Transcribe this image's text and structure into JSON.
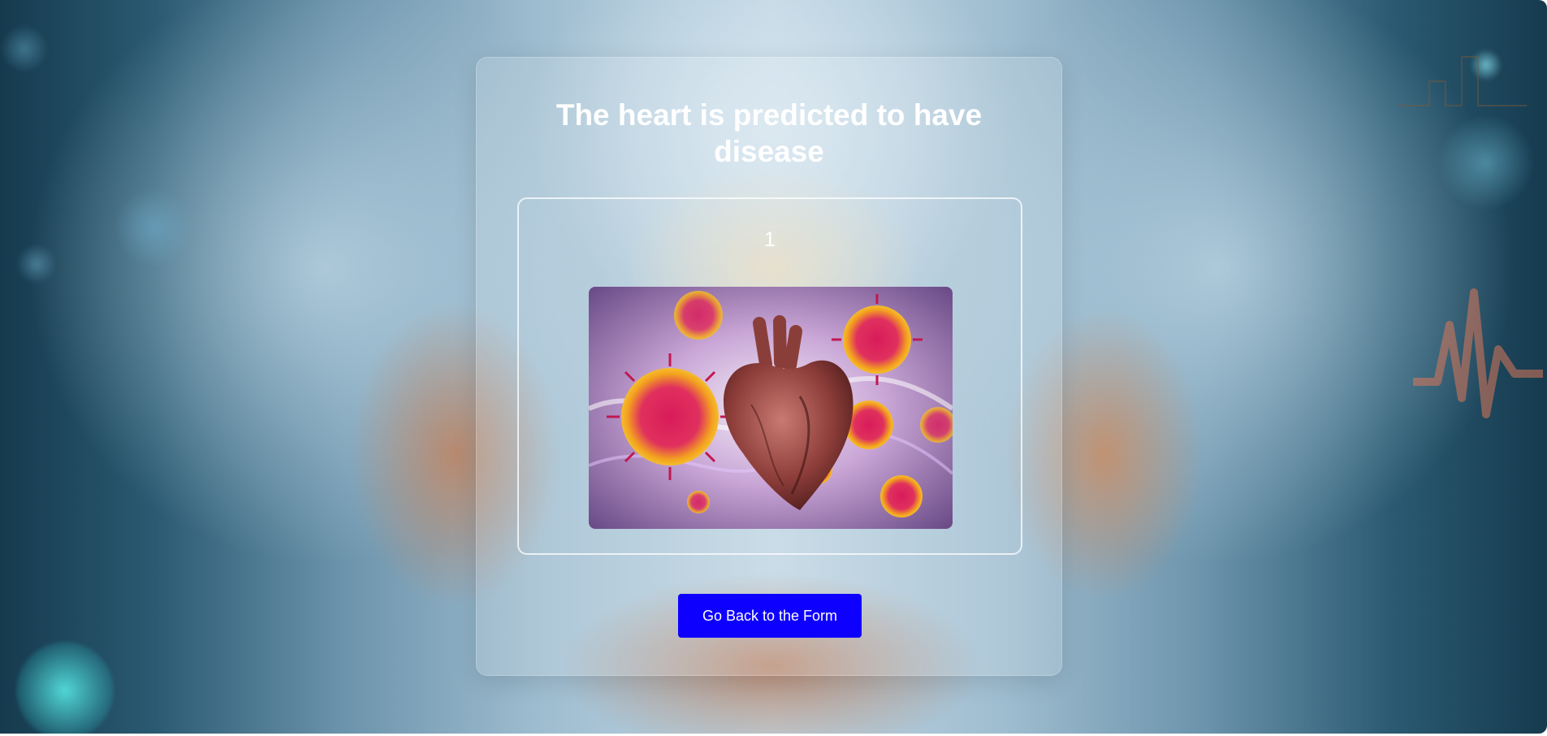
{
  "result": {
    "heading": "The heart is predicted to have disease",
    "prediction_value": "1",
    "image_icon": "diseased-heart-with-virus-illustration"
  },
  "actions": {
    "back_label": "Go Back to the Form"
  },
  "colors": {
    "button_background": "#0e00ff",
    "button_text": "#ffffff",
    "heading_text": "#ffffff"
  }
}
